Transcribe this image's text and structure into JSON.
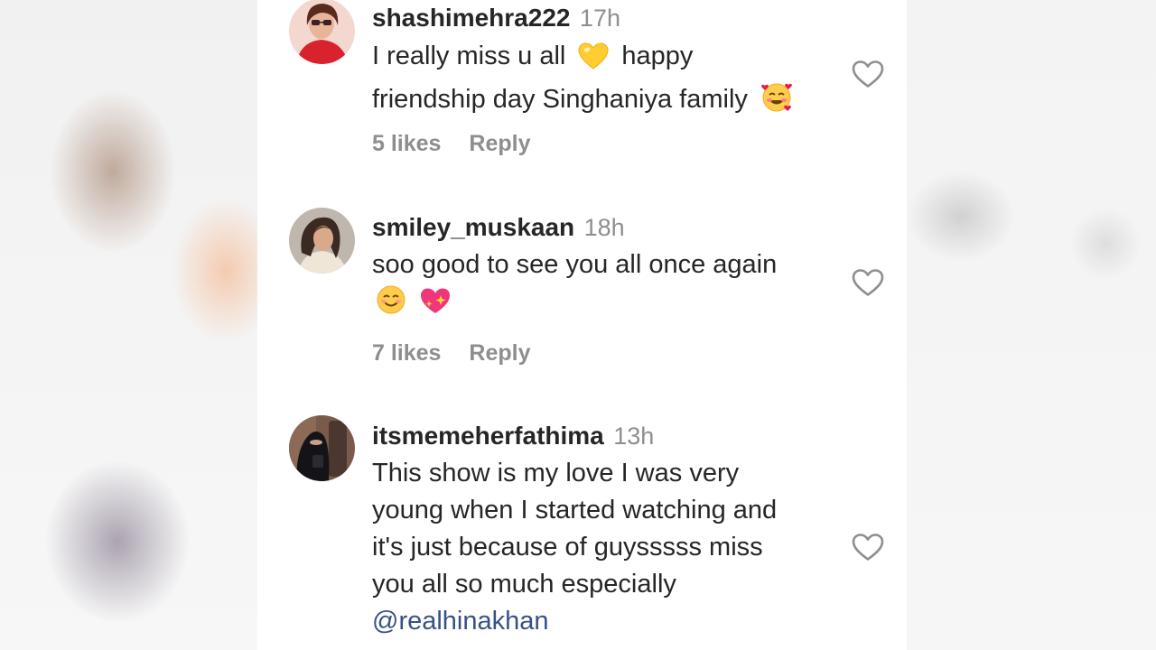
{
  "comments": [
    {
      "username": "shashimehra222",
      "time": "17h",
      "lines": [
        "I really miss u all",
        "happy",
        "friendship day Singhaniya family"
      ],
      "emojis": [
        "yellow-heart",
        "smiling-face-with-hearts"
      ],
      "likes": "5 likes",
      "reply": "Reply"
    },
    {
      "username": "smiley_muskaan",
      "time": "18h",
      "lines": [
        "soo good to see you all once again"
      ],
      "emojis": [
        "smiling-face",
        "sparkling-heart"
      ],
      "likes": "7 likes",
      "reply": "Reply"
    },
    {
      "username": "itsmemeherfathima",
      "time": "13h",
      "lines": [
        "This show is my love I was very",
        "young when I started watching and",
        "it's just because of guysssss miss",
        "you all so much especially"
      ],
      "mention": "@realhinakhan"
    }
  ],
  "colors": {
    "text": "#262626",
    "secondary": "#8e8e8e",
    "mention": "#385185",
    "heart_outline": "#8e8e8e"
  }
}
